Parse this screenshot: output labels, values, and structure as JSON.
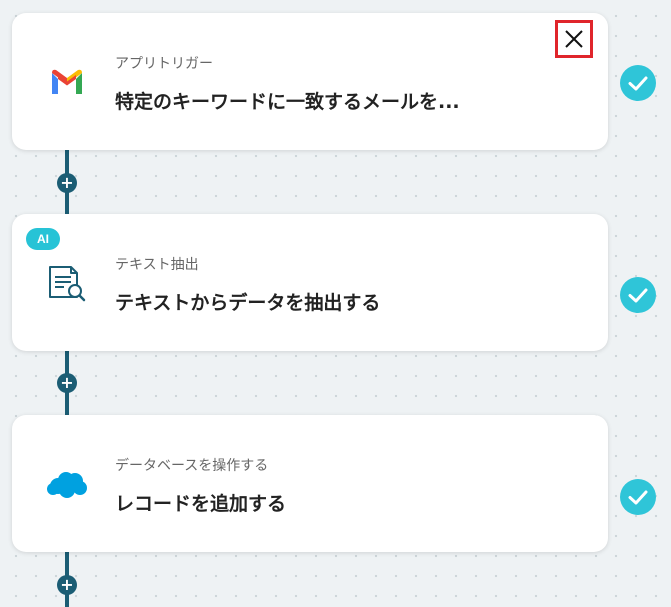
{
  "steps": [
    {
      "subtitle": "アプリトリガー",
      "title": "特定のキーワードに一致するメールを...",
      "icon": "gmail-icon",
      "status": "completed"
    },
    {
      "badge": "AI",
      "subtitle": "テキスト抽出",
      "title": "テキストからデータを抽出する",
      "icon": "document-search-icon",
      "status": "completed"
    },
    {
      "subtitle": "データベースを操作する",
      "title": "レコードを追加する",
      "icon": "salesforce-cloud-icon",
      "status": "completed"
    }
  ],
  "colors": {
    "connector": "#1b5d74",
    "check": "#2fc5d8",
    "ai_badge": "#27c3d6",
    "close_highlight": "#e0252b"
  }
}
